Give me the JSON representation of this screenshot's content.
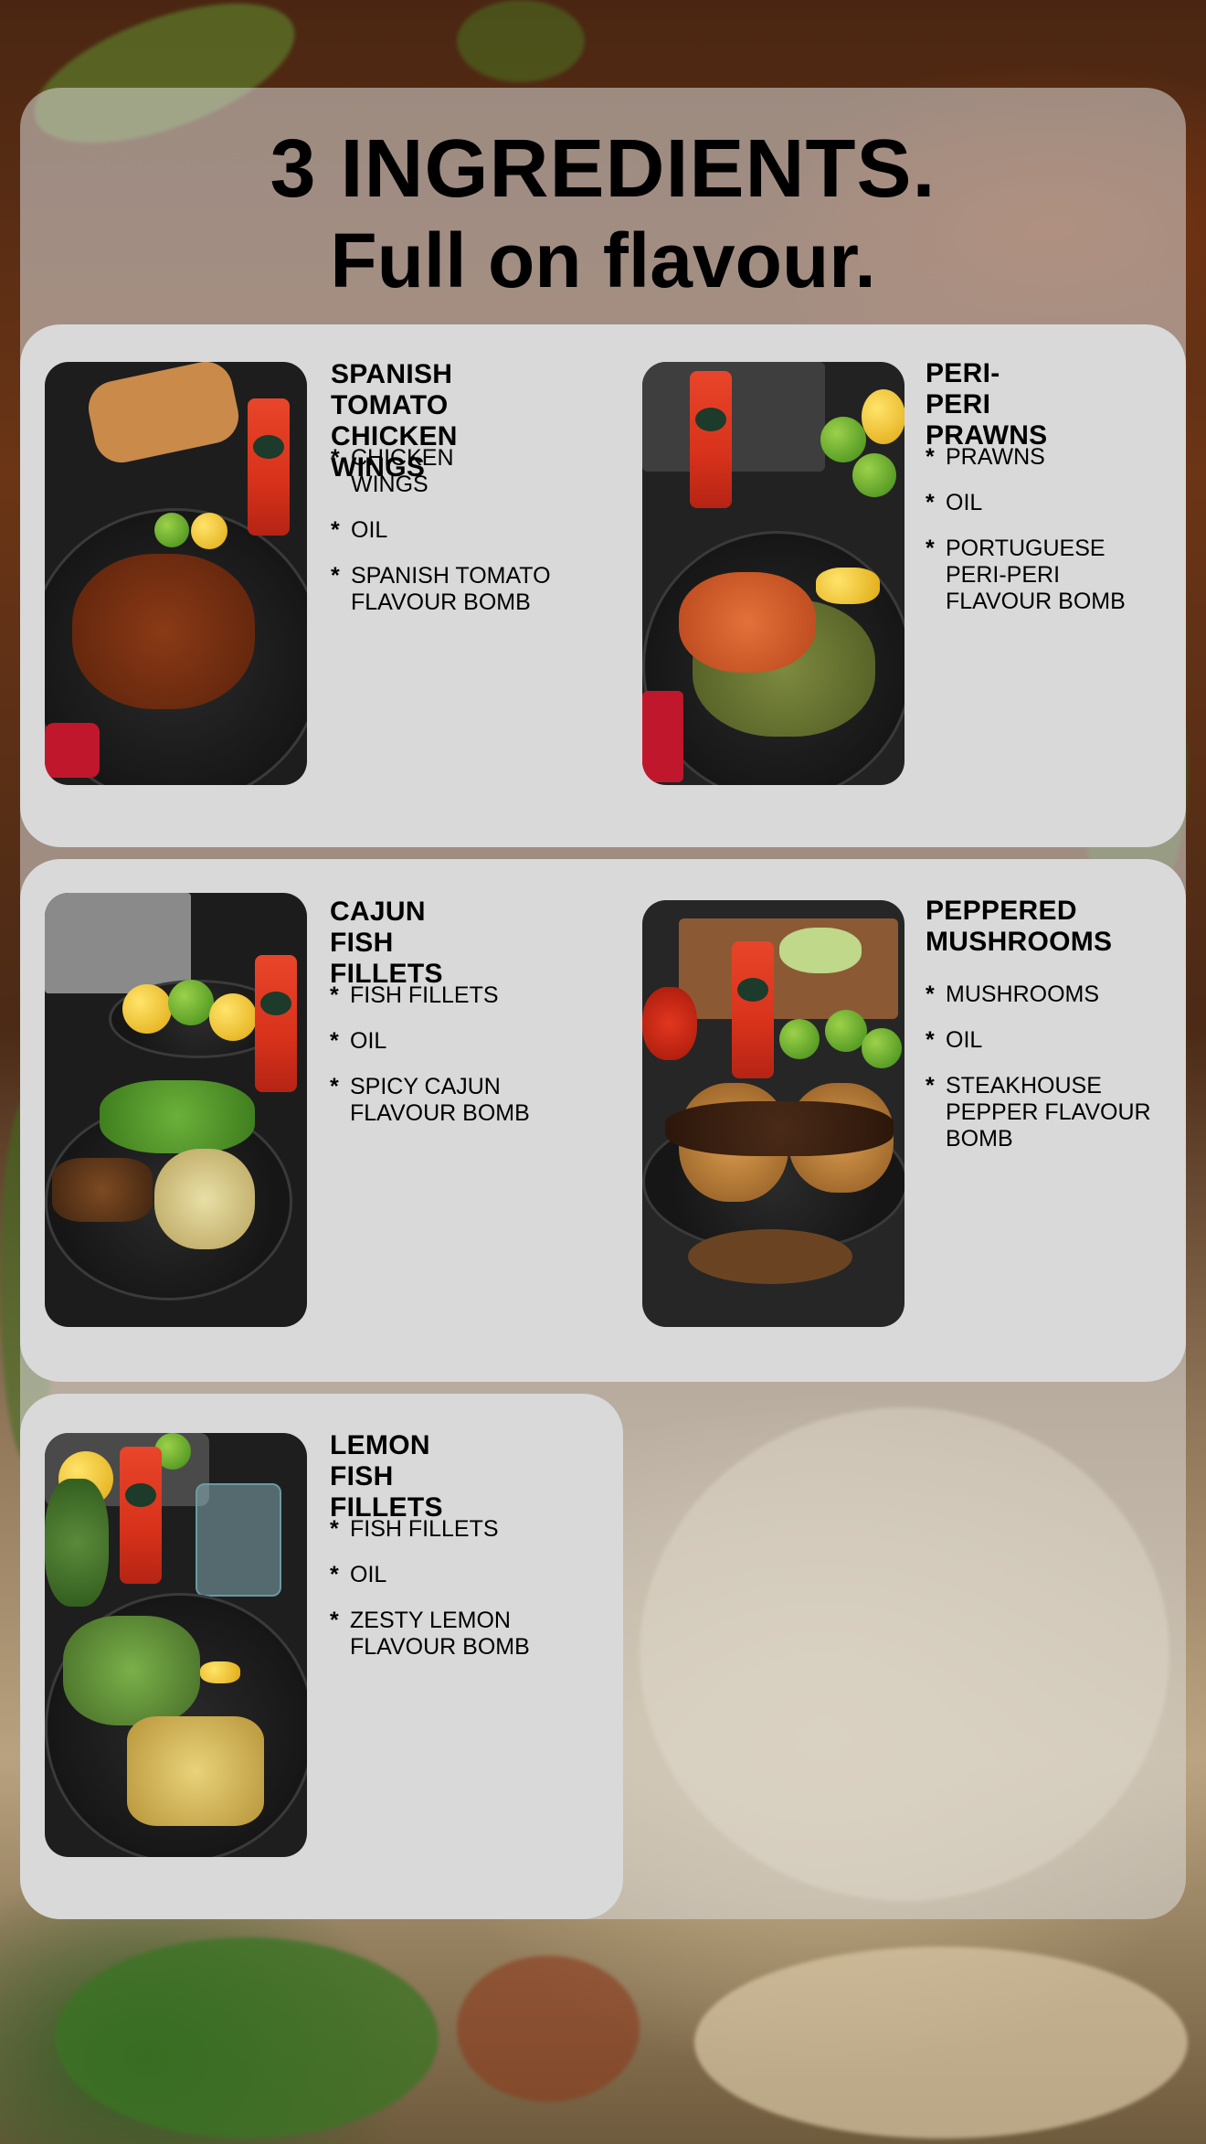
{
  "headline": {
    "line1": "3 INGREDIENTS.",
    "line2": "Full on flavour."
  },
  "recipes": [
    {
      "title_line1": "SPANISH TOMATO",
      "title_line2": "CHICKEN WINGS",
      "ingredients": [
        "CHICKEN WINGS",
        "OIL",
        "SPANISH TOMATO FLAVOUR BOMB"
      ]
    },
    {
      "title_line1": "PERI-PERI",
      "title_line2": "PRAWNS",
      "ingredients": [
        "PRAWNS",
        "OIL",
        "PORTUGUESE PERI-PERI FLAVOUR BOMB"
      ]
    },
    {
      "title_line1": "CAJUN FISH",
      "title_line2": "FILLETS",
      "ingredients": [
        "FISH FILLETS",
        "OIL",
        "SPICY CAJUN FLAVOUR BOMB"
      ]
    },
    {
      "title_line1": "PEPPERED",
      "title_line2": "MUSHROOMS",
      "ingredients": [
        "MUSHROOMS",
        "OIL",
        "STEAKHOUSE PEPPER FLAVOUR BOMB"
      ]
    },
    {
      "title_line1": "LEMON FISH",
      "title_line2": "FILLETS",
      "ingredients": [
        "FISH FILLETS",
        "OIL",
        "ZESTY LEMON FLAVOUR BOMB"
      ]
    }
  ],
  "bullet": "*",
  "colors": {
    "panel": "#dddddd",
    "card": "#d9d9d9",
    "text": "#000000",
    "bottle": "#d8321b"
  },
  "icons": [
    "photo-chicken-wings",
    "photo-prawns",
    "photo-cajun-fish",
    "photo-mushroom-burgers",
    "photo-lemon-fish"
  ]
}
